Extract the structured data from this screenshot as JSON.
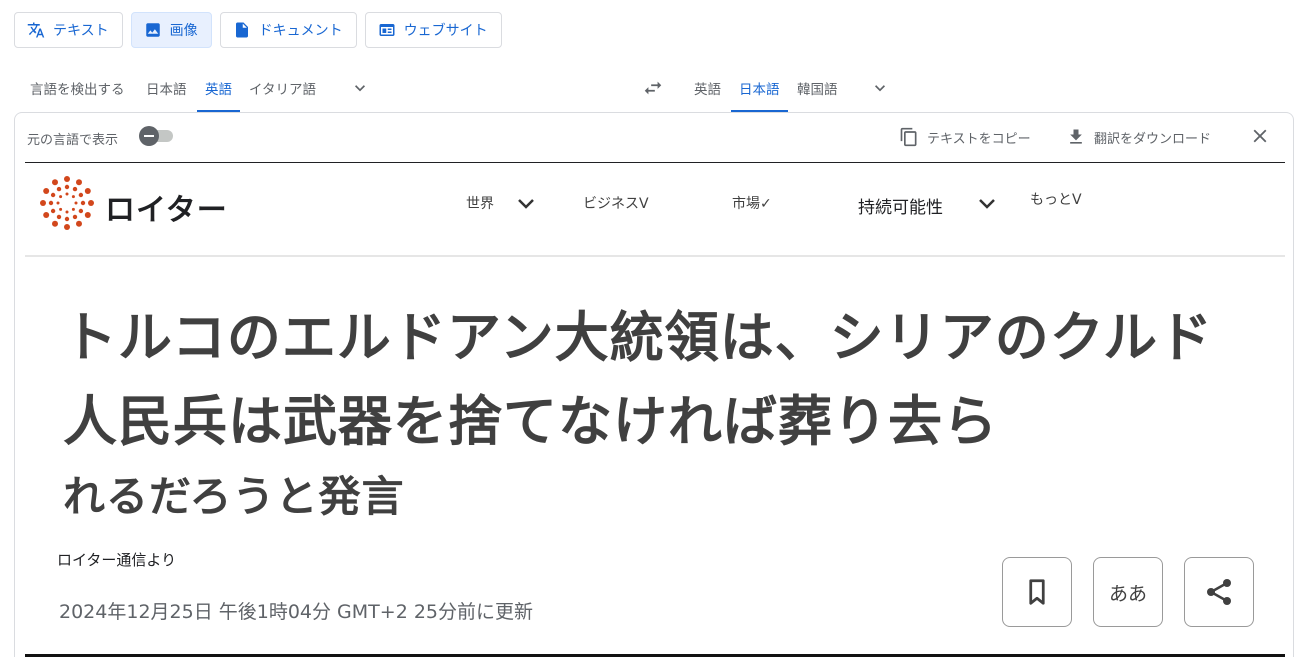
{
  "modes": [
    {
      "label": "テキスト",
      "icon": "translate-icon",
      "active": false
    },
    {
      "label": "画像",
      "icon": "image-icon",
      "active": true
    },
    {
      "label": "ドキュメント",
      "icon": "document-icon",
      "active": false
    },
    {
      "label": "ウェブサイト",
      "icon": "website-icon",
      "active": false
    }
  ],
  "source_langs": [
    "言語を検出する",
    "日本語",
    "英語",
    "イタリア語"
  ],
  "source_active": "英語",
  "target_langs": [
    "英語",
    "日本語",
    "韓国語"
  ],
  "target_active": "日本語",
  "toolbar": {
    "show_original": "元の言語で表示",
    "copy_text": "テキストをコピー",
    "download": "翻訳をダウンロード"
  },
  "page": {
    "site_name": "ロイター",
    "nav": [
      "世界",
      "ビジネスV",
      "市場✓",
      "持続可能性",
      "もっとV"
    ],
    "headline": [
      "トルコのエルドアン大統領は、シリアのクルド",
      "人民兵は武器を捨てなければ葬り去ら",
      "れるだろうと発言"
    ],
    "byline": "ロイター通信より",
    "dateline": "2024年12月25日 午後1時04分 GMT+2 25分前に更新",
    "text_size_button": "ああ"
  },
  "colors": {
    "accent": "#1967d2",
    "logo": "#d2471c"
  }
}
